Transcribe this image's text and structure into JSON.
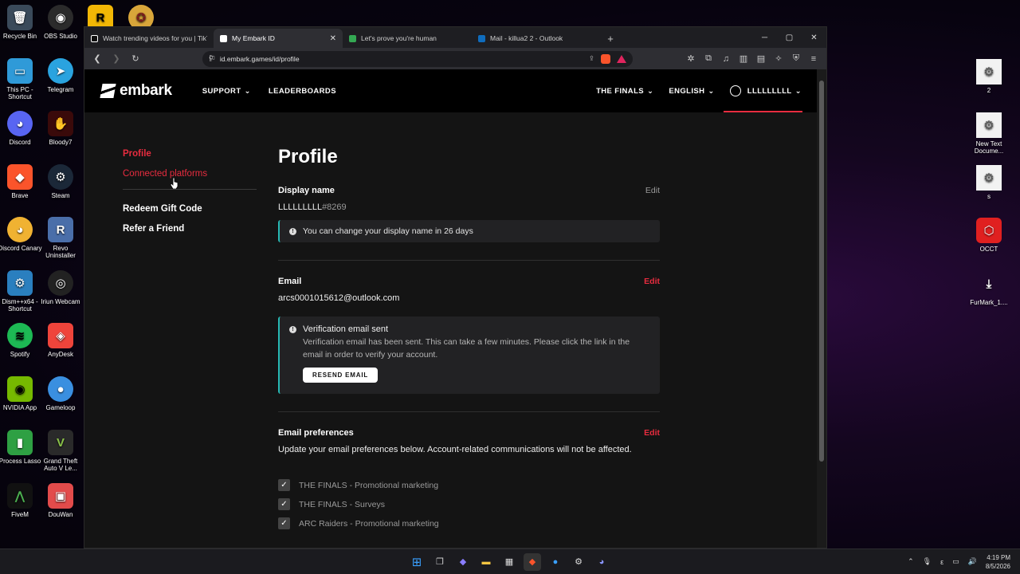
{
  "desktop": {
    "left_icons": [
      {
        "label": "Recycle Bin",
        "icon": "recycle-bin-icon",
        "color": "#3a4a5a",
        "glyph": "🗑"
      },
      {
        "label": "OBS Studio",
        "icon": "obs-icon",
        "color": "#2b2b2b",
        "glyph": "◉"
      },
      {
        "label": "This PC - Shortcut",
        "icon": "monitor-icon",
        "color": "#2f9ad8",
        "glyph": "▭"
      },
      {
        "label": "Telegram",
        "icon": "telegram-icon",
        "color": "#2aa3df",
        "glyph": "➤"
      },
      {
        "label": "Discord",
        "icon": "discord-icon",
        "color": "#5865f2",
        "glyph": "◕"
      },
      {
        "label": "Bloody7",
        "icon": "bloody-icon",
        "color": "#b71c1c",
        "glyph": "✋"
      },
      {
        "label": "Brave",
        "icon": "brave-icon",
        "color": "#fb542b",
        "glyph": "◆"
      },
      {
        "label": "Steam",
        "icon": "steam-icon",
        "color": "#1b2838",
        "glyph": "⚙"
      },
      {
        "label": "Discord Canary",
        "icon": "discord-canary-icon",
        "color": "#f0b232",
        "glyph": "◕"
      },
      {
        "label": "Revo Uninstaller",
        "icon": "revo-icon",
        "color": "#4a6ea9",
        "glyph": "R"
      },
      {
        "label": "Dism++x64 - Shortcut",
        "icon": "gear-icon",
        "color": "#2a7fbf",
        "glyph": "⚙"
      },
      {
        "label": "Iriun Webcam",
        "icon": "webcam-icon",
        "color": "#222222",
        "glyph": "◎"
      },
      {
        "label": "Spotify",
        "icon": "spotify-icon",
        "color": "#1db954",
        "glyph": "≋"
      },
      {
        "label": "AnyDesk",
        "icon": "anydesk-icon",
        "color": "#ef443b",
        "glyph": "◈"
      },
      {
        "label": "NVIDIA App",
        "icon": "nvidia-icon",
        "color": "#76b900",
        "glyph": "◉"
      },
      {
        "label": "Gameloop",
        "icon": "gameloop-icon",
        "color": "#3a8fe0",
        "glyph": "●"
      },
      {
        "label": "Process Lasso",
        "icon": "process-lasso-icon",
        "color": "#2ea043",
        "glyph": "▮"
      },
      {
        "label": "Grand Theft Auto V Le...",
        "icon": "gta-icon",
        "color": "#2a2a2a",
        "glyph": "V"
      },
      {
        "label": "FiveM",
        "icon": "fivem-icon",
        "color": "#111111",
        "glyph": "⋀"
      },
      {
        "label": "DouWan",
        "icon": "douwan-icon",
        "color": "#e24b4b",
        "glyph": "▣"
      }
    ],
    "top_icons": [
      {
        "icon": "rockstar-icon",
        "color": "#f2b705",
        "glyph": "R"
      },
      {
        "icon": "game-icon",
        "color": "#d9a63a",
        "glyph": "✪"
      }
    ],
    "right_icons": [
      {
        "label": "2",
        "icon": "settings-file-icon"
      },
      {
        "label": "New Text Docume...",
        "icon": "settings-file-icon"
      },
      {
        "label": "s",
        "icon": "settings-file-icon"
      },
      {
        "label": "OCCT",
        "icon": "occt-icon"
      },
      {
        "label": "FurMark_1....",
        "icon": "download-icon"
      }
    ]
  },
  "browser": {
    "tabs": [
      {
        "title": "Watch trending videos for you | TikTok",
        "color": "#ffffff",
        "active": false
      },
      {
        "title": "My Embark ID",
        "color": "#ffffff",
        "active": true
      },
      {
        "title": "Let's prove you're human",
        "color": "#34a853",
        "active": false
      },
      {
        "title": "Mail - killua2 2 - Outlook",
        "color": "#0f6cbd",
        "active": false
      }
    ],
    "url": "id.embark.games/id/profile"
  },
  "site": {
    "logo_text": "embark",
    "nav_left": [
      "SUPPORT",
      "LEADERBOARDS"
    ],
    "nav_right": [
      "THE FINALS",
      "ENGLISH",
      "LLLLLLLLL"
    ],
    "sidebar": {
      "profile": "Profile",
      "connected": "Connected platforms",
      "redeem": "Redeem Gift Code",
      "refer": "Refer a Friend"
    },
    "title": "Profile",
    "display_name": {
      "label": "Display name",
      "edit": "Edit",
      "value": "LLLLLLLLL",
      "tag": "#8269",
      "notice": "You can change your display name in 26 days"
    },
    "email": {
      "label": "Email",
      "edit": "Edit",
      "value": "arcs0001015612@outlook.com",
      "notice_title": "Verification email sent",
      "notice_body": "Verification email has been sent. This can take a few minutes. Please click the link in the email in order to verify your account.",
      "resend": "RESEND EMAIL"
    },
    "prefs": {
      "label": "Email preferences",
      "edit": "Edit",
      "desc": "Update your email preferences below. Account-related communications will not be affected.",
      "items": [
        "THE FINALS - Promotional marketing",
        "THE FINALS - Surveys",
        "ARC Raiders - Promotional marketing"
      ]
    }
  },
  "taskbar": {
    "time": "4:19 PM",
    "date": "8/5/2026"
  }
}
